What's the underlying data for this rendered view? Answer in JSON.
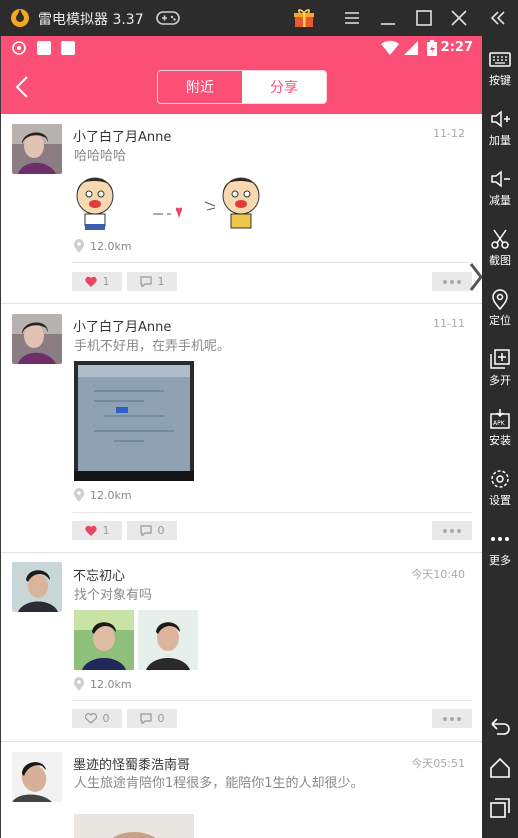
{
  "emulator": {
    "title": "雷电模拟器 3.37",
    "sidebar": [
      {
        "icon": "keyboard-icon",
        "label": "按键"
      },
      {
        "icon": "volume-up-icon",
        "label": "加量"
      },
      {
        "icon": "volume-down-icon",
        "label": "减量"
      },
      {
        "icon": "scissors-icon",
        "label": "截图"
      },
      {
        "icon": "location-pin-icon",
        "label": "定位"
      },
      {
        "icon": "multi-open-icon",
        "label": "多开"
      },
      {
        "icon": "apk-install-icon",
        "label": "安装"
      },
      {
        "icon": "settings-gear-icon",
        "label": "设置"
      },
      {
        "icon": "more-dots-icon",
        "label": "更多"
      }
    ]
  },
  "statusbar": {
    "time": "2:27"
  },
  "appbar": {
    "tabs": [
      "附近",
      "分享"
    ],
    "active_tab": "分享"
  },
  "colors": {
    "accent": "#fb4f76",
    "like_heart": "#e8485f"
  },
  "posts": [
    {
      "user": "小了白了月Anne",
      "date": "11-12",
      "text": "哈哈哈哈",
      "distance": "12.0km",
      "likes": "1",
      "comments": "1",
      "liked": true,
      "media": "sticker-heart"
    },
    {
      "user": "小了白了月Anne",
      "date": "11-11",
      "text": "手机不好用，在弄手机呢。",
      "distance": "12.0km",
      "likes": "1",
      "comments": "0",
      "liked": true,
      "media": "monitor-photo"
    },
    {
      "user": "不忘初心",
      "date": "今天10:40",
      "text": "找个对象有吗",
      "distance": "12.0km",
      "likes": "0",
      "comments": "0",
      "liked": false,
      "media": "two-selfies"
    },
    {
      "user": "墨迹的怪蜀黍浩南哥",
      "date": "今天05:51",
      "text": "人生旅途肯陪你1程很多，能陪你1生的人却很少。"
    }
  ]
}
